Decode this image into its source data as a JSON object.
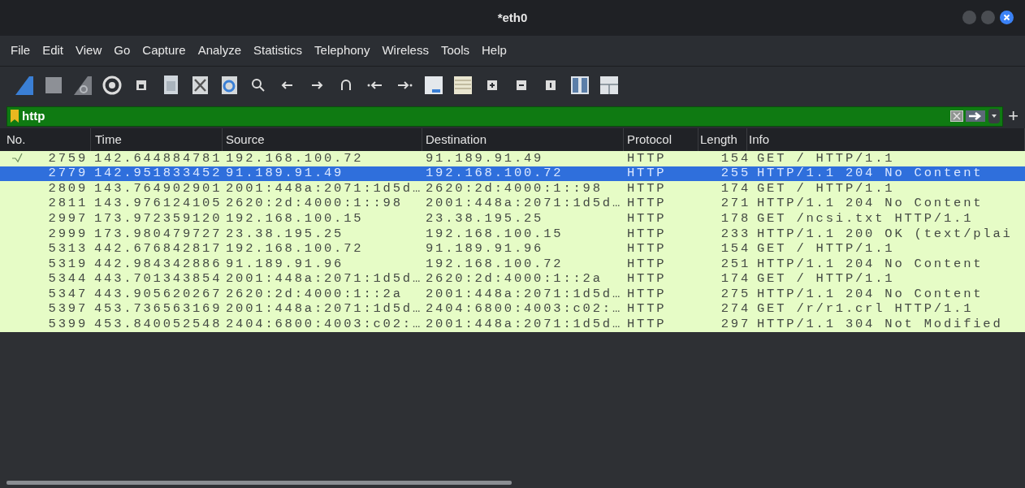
{
  "window": {
    "title": "*eth0"
  },
  "menu": [
    "File",
    "Edit",
    "View",
    "Go",
    "Capture",
    "Analyze",
    "Statistics",
    "Telephony",
    "Wireless",
    "Tools",
    "Help"
  ],
  "filter": {
    "value": "http",
    "plus": "+"
  },
  "table": {
    "columns": [
      "No.",
      "Time",
      "Source",
      "Destination",
      "Protocol",
      "Length",
      "Info"
    ],
    "rows": [
      {
        "no": "2759",
        "time": "142.644884781",
        "source": "192.168.100.72",
        "destination": "91.189.91.49",
        "protocol": "HTTP",
        "length": "154",
        "info": "GET / HTTP/1.1",
        "selected": false,
        "related": true
      },
      {
        "no": "2779",
        "time": "142.951833452",
        "source": "91.189.91.49",
        "destination": "192.168.100.72",
        "protocol": "HTTP",
        "length": "255",
        "info": "HTTP/1.1 204 No Content",
        "selected": true,
        "related": false
      },
      {
        "no": "2809",
        "time": "143.764902901",
        "source": "2001:448a:2071:1d5d…",
        "destination": "2620:2d:4000:1::98",
        "protocol": "HTTP",
        "length": "174",
        "info": "GET / HTTP/1.1",
        "selected": false,
        "related": false
      },
      {
        "no": "2811",
        "time": "143.976124105",
        "source": "2620:2d:4000:1::98",
        "destination": "2001:448a:2071:1d5d…",
        "protocol": "HTTP",
        "length": "271",
        "info": "HTTP/1.1 204 No Content",
        "selected": false,
        "related": false
      },
      {
        "no": "2997",
        "time": "173.972359120",
        "source": "192.168.100.15",
        "destination": "23.38.195.25",
        "protocol": "HTTP",
        "length": "178",
        "info": "GET /ncsi.txt HTTP/1.1",
        "selected": false,
        "related": false
      },
      {
        "no": "2999",
        "time": "173.980479727",
        "source": "23.38.195.25",
        "destination": "192.168.100.15",
        "protocol": "HTTP",
        "length": "233",
        "info": "HTTP/1.1 200 OK  (text/plai",
        "selected": false,
        "related": false
      },
      {
        "no": "5313",
        "time": "442.676842817",
        "source": "192.168.100.72",
        "destination": "91.189.91.96",
        "protocol": "HTTP",
        "length": "154",
        "info": "GET / HTTP/1.1",
        "selected": false,
        "related": false
      },
      {
        "no": "5319",
        "time": "442.984342886",
        "source": "91.189.91.96",
        "destination": "192.168.100.72",
        "protocol": "HTTP",
        "length": "251",
        "info": "HTTP/1.1 204 No Content",
        "selected": false,
        "related": false
      },
      {
        "no": "5344",
        "time": "443.701343854",
        "source": "2001:448a:2071:1d5d…",
        "destination": "2620:2d:4000:1::2a",
        "protocol": "HTTP",
        "length": "174",
        "info": "GET / HTTP/1.1",
        "selected": false,
        "related": false
      },
      {
        "no": "5347",
        "time": "443.905620267",
        "source": "2620:2d:4000:1::2a",
        "destination": "2001:448a:2071:1d5d…",
        "protocol": "HTTP",
        "length": "275",
        "info": "HTTP/1.1 204 No Content",
        "selected": false,
        "related": false
      },
      {
        "no": "5397",
        "time": "453.736563169",
        "source": "2001:448a:2071:1d5d…",
        "destination": "2404:6800:4003:c02:…",
        "protocol": "HTTP",
        "length": "274",
        "info": "GET /r/r1.crl HTTP/1.1",
        "selected": false,
        "related": false
      },
      {
        "no": "5399",
        "time": "453.840052548",
        "source": "2404:6800:4003:c02:…",
        "destination": "2001:448a:2071:1d5d…",
        "protocol": "HTTP",
        "length": "297",
        "info": "HTTP/1.1 304 Not Modified",
        "selected": false,
        "related": false
      }
    ]
  }
}
